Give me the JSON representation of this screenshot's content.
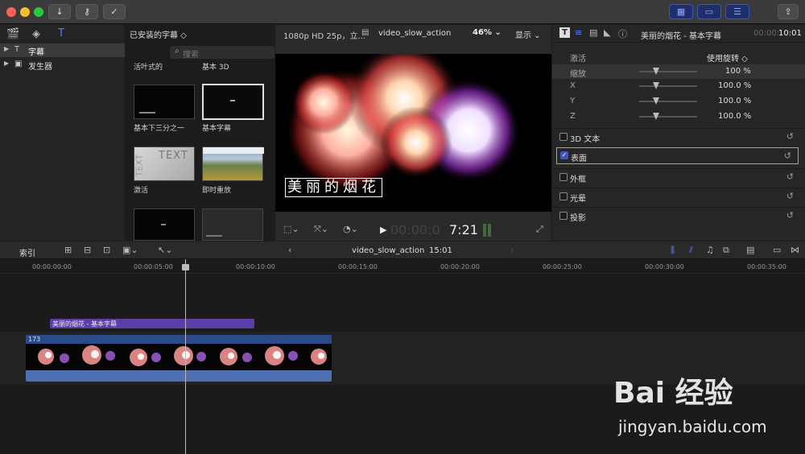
{
  "toolbar": {
    "download_icon": "arrow-down-icon",
    "key_icon": "key-icon",
    "check_icon": "checkmark-icon",
    "share_icon": "share-icon"
  },
  "library": {
    "items": [
      {
        "label": "字幕",
        "selected": true
      },
      {
        "label": "发生器",
        "selected": false
      }
    ]
  },
  "browser": {
    "title": "已安装的字幕 ◇",
    "search_placeholder": "搜索",
    "items": [
      {
        "label": "活叶式的"
      },
      {
        "label": "基本 3D"
      },
      {
        "label": "基本下三分之一"
      },
      {
        "label": "基本字幕"
      },
      {
        "label": "激活"
      },
      {
        "label": "即时重放"
      }
    ],
    "thumb_text_1": "TEXT",
    "thumb_text_2": "TEXT"
  },
  "viewer": {
    "format": "1080p HD 25p，立...",
    "clip_name": "video_slow_action",
    "zoom": "46%",
    "display_menu": "显示",
    "overlay_title": "美丽的烟花",
    "timecode_dim": "00:00:0",
    "timecode_bright": "7:21"
  },
  "inspector": {
    "title": "美丽的烟花 - 基本字幕",
    "duration_dim": "00:00:",
    "duration_bright": "10:01",
    "animate_label": "激活",
    "animate_value": "使用旋转 ◇",
    "scale_label": "缩放",
    "scale_value": "100 %",
    "x_label": "X",
    "x_value": "100.0 %",
    "y_label": "Y",
    "y_value": "100.0 %",
    "z_label": "Z",
    "z_value": "100.0 %",
    "sections": [
      {
        "label": "3D 文本",
        "checked": false
      },
      {
        "label": "表面",
        "checked": true
      },
      {
        "label": "外框",
        "checked": false
      },
      {
        "label": "光晕",
        "checked": false
      },
      {
        "label": "投影",
        "checked": false
      }
    ]
  },
  "timeline": {
    "index_label": "索引",
    "project_name": "video_slow_action",
    "project_duration": "15:01",
    "ruler": [
      "00:00:00:00",
      "00:00:05:00",
      "00:00:10:00",
      "00:00:15:00",
      "00:00:20:00",
      "00:00:25:00",
      "00:00:30:00",
      "00:00:35:00"
    ],
    "title_clip": "美丽的烟花 - 基本字幕",
    "video_clip_count": "173"
  },
  "watermark": {
    "brand": "Bai 经验",
    "url": "jingyan.baidu.com"
  },
  "colors": {
    "accent_blue": "#3c57c0",
    "title_clip": "#5b3ea8",
    "video_clip": "#2b4a8a",
    "selection_yellow": "#c8a82a"
  }
}
